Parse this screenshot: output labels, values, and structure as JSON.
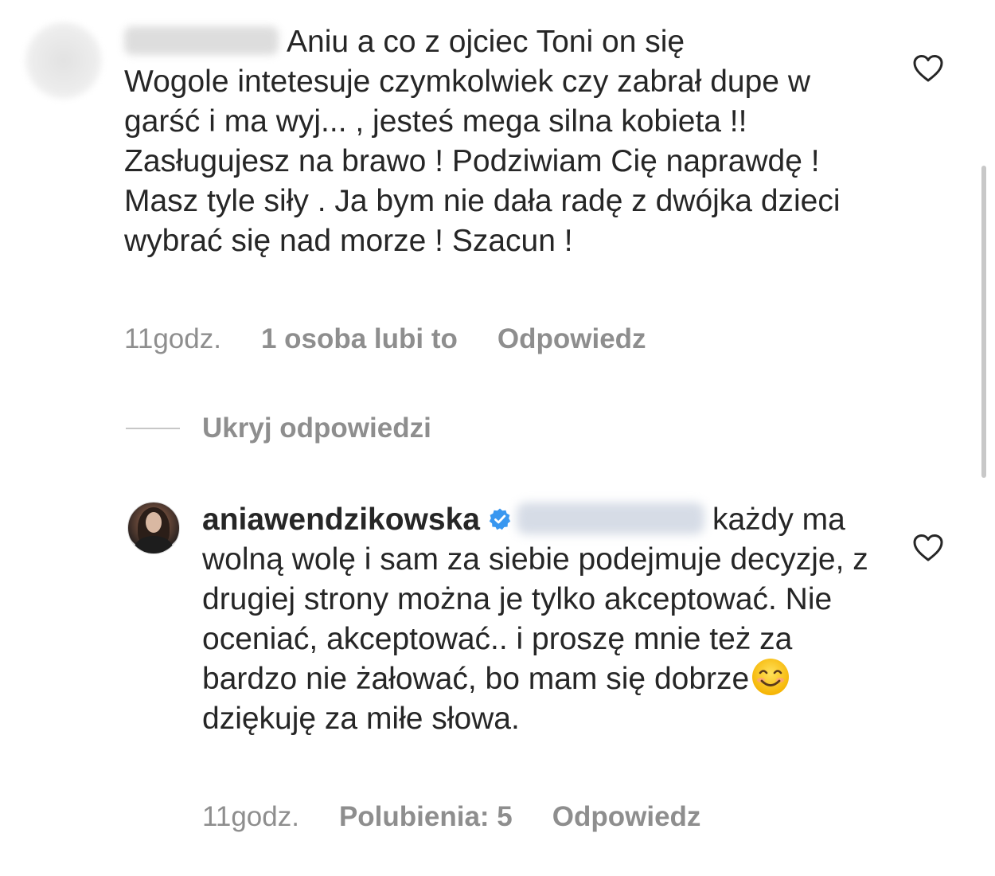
{
  "comment": {
    "text_line_1": "Aniu a co z ojciec Toni on się",
    "text_rest": "Wogole intetesuje czymkolwiek czy zabrał dupe w garść i ma wyj... , jesteś mega silna kobieta !! Zasługujesz na brawo ! Podziwiam Cię naprawdę ! Masz tyle siły . Ja bym nie dała radę z dwójka dzieci wybrać się nad morze ! Szacun !",
    "time": "11godz.",
    "likes": "1 osoba lubi to",
    "reply_label": "Odpowiedz",
    "like_icon": "heart-outline-icon"
  },
  "replies_toggle": {
    "label": "Ukryj odpowiedzi"
  },
  "reply": {
    "author": "aniawendzikowska",
    "verified_icon": "verified-badge-icon",
    "text_part_1": "każdy ma wolną wolę i sam za siebie podejmuje decyzje, z drugiej strony można je tylko akceptować. Nie oceniać, akceptować.. i proszę mnie też za bardzo nie żałować, bo mam się dobrze",
    "emoji_icon": "smiling-face-emoji-icon",
    "text_part_2": " dziękuję za miłe słowa.",
    "time": "11godz.",
    "likes": "Polubienia: 5",
    "reply_label": "Odpowiedz",
    "like_icon": "heart-outline-icon"
  },
  "colors": {
    "text": "#262626",
    "secondary": "#8e8e8e",
    "verified": "#3897f0"
  }
}
